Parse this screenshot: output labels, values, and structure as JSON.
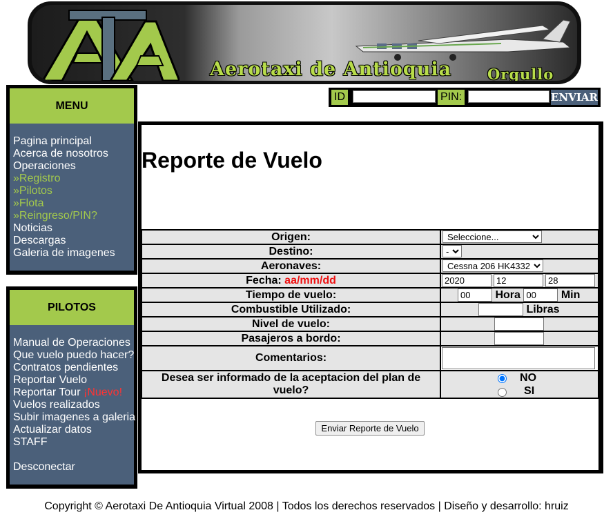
{
  "banner": {
    "logo_letters": "ATA",
    "brand": "Aerotaxi de Antioquia",
    "tagline": "Orgullo Paisa",
    "colors": {
      "accent": "#a3c94c",
      "panel": "#4b607a",
      "frame": "#000000"
    }
  },
  "login": {
    "id_label": "ID",
    "pin_label": "PIN:",
    "id_value": "",
    "pin_value": "",
    "send_label": "ENVIAR"
  },
  "menu": {
    "title": "MENU",
    "items": [
      {
        "label": "Pagina principal",
        "sub": false
      },
      {
        "label": "Acerca de nosotros",
        "sub": false
      },
      {
        "label": "Operaciones",
        "sub": false
      },
      {
        "label": "»Registro",
        "sub": true
      },
      {
        "label": "»Pilotos",
        "sub": true
      },
      {
        "label": "»Flota",
        "sub": true
      },
      {
        "label": "»Reingreso/PIN?",
        "sub": true
      },
      {
        "label": "Noticias",
        "sub": false
      },
      {
        "label": "Descargas",
        "sub": false
      },
      {
        "label": "Galeria de imagenes",
        "sub": false
      }
    ]
  },
  "pilotos": {
    "title": "PILOTOS",
    "items": [
      "Manual de Operaciones",
      "Que vuelo puedo hacer?",
      "Contratos pendientes",
      "Reportar Vuelo",
      "Reportar Tour",
      "Vuelos realizados",
      "Subir imagenes a galeria",
      "Actualizar datos",
      "STAFF",
      "Desconectar"
    ],
    "nuevo_badge": "¡Nuevo!"
  },
  "form": {
    "title": "Reporte de Vuelo",
    "labels": {
      "origen": "Origen:",
      "destino": "Destino:",
      "aeronaves": "Aeronaves:",
      "fecha": "Fecha:",
      "fecha_format": "aa/mm/dd",
      "tiempo": "Tiempo de vuelo:",
      "combustible": "Combustible Utilizado:",
      "nivel": "Nivel de vuelo:",
      "pasajeros": "Pasajeros a bordo:",
      "comentarios": "Comentarios:",
      "informar": "Desea ser informado de la aceptacion del plan de vuelo?"
    },
    "values": {
      "origen": "Seleccione...",
      "destino": "-",
      "aeronave": "Cessna 206 HK4332",
      "fecha_year": "2020",
      "fecha_month": "12",
      "fecha_day": "28",
      "hora": "00",
      "min": "00",
      "combustible": "",
      "nivel": "",
      "pasajeros": "",
      "comentarios": ""
    },
    "units": {
      "hora": "Hora",
      "min": "Min",
      "libras": "Libras"
    },
    "radio": {
      "no_label": "NO",
      "si_label": "SI",
      "selected": "NO"
    },
    "submit_label": "Enviar Reporte de Vuelo"
  },
  "footer": {
    "text": "Copyright © Aerotaxi De Antioquia Virtual 2008 | Todos los derechos reservados | Diseño y desarrollo: hruiz"
  }
}
